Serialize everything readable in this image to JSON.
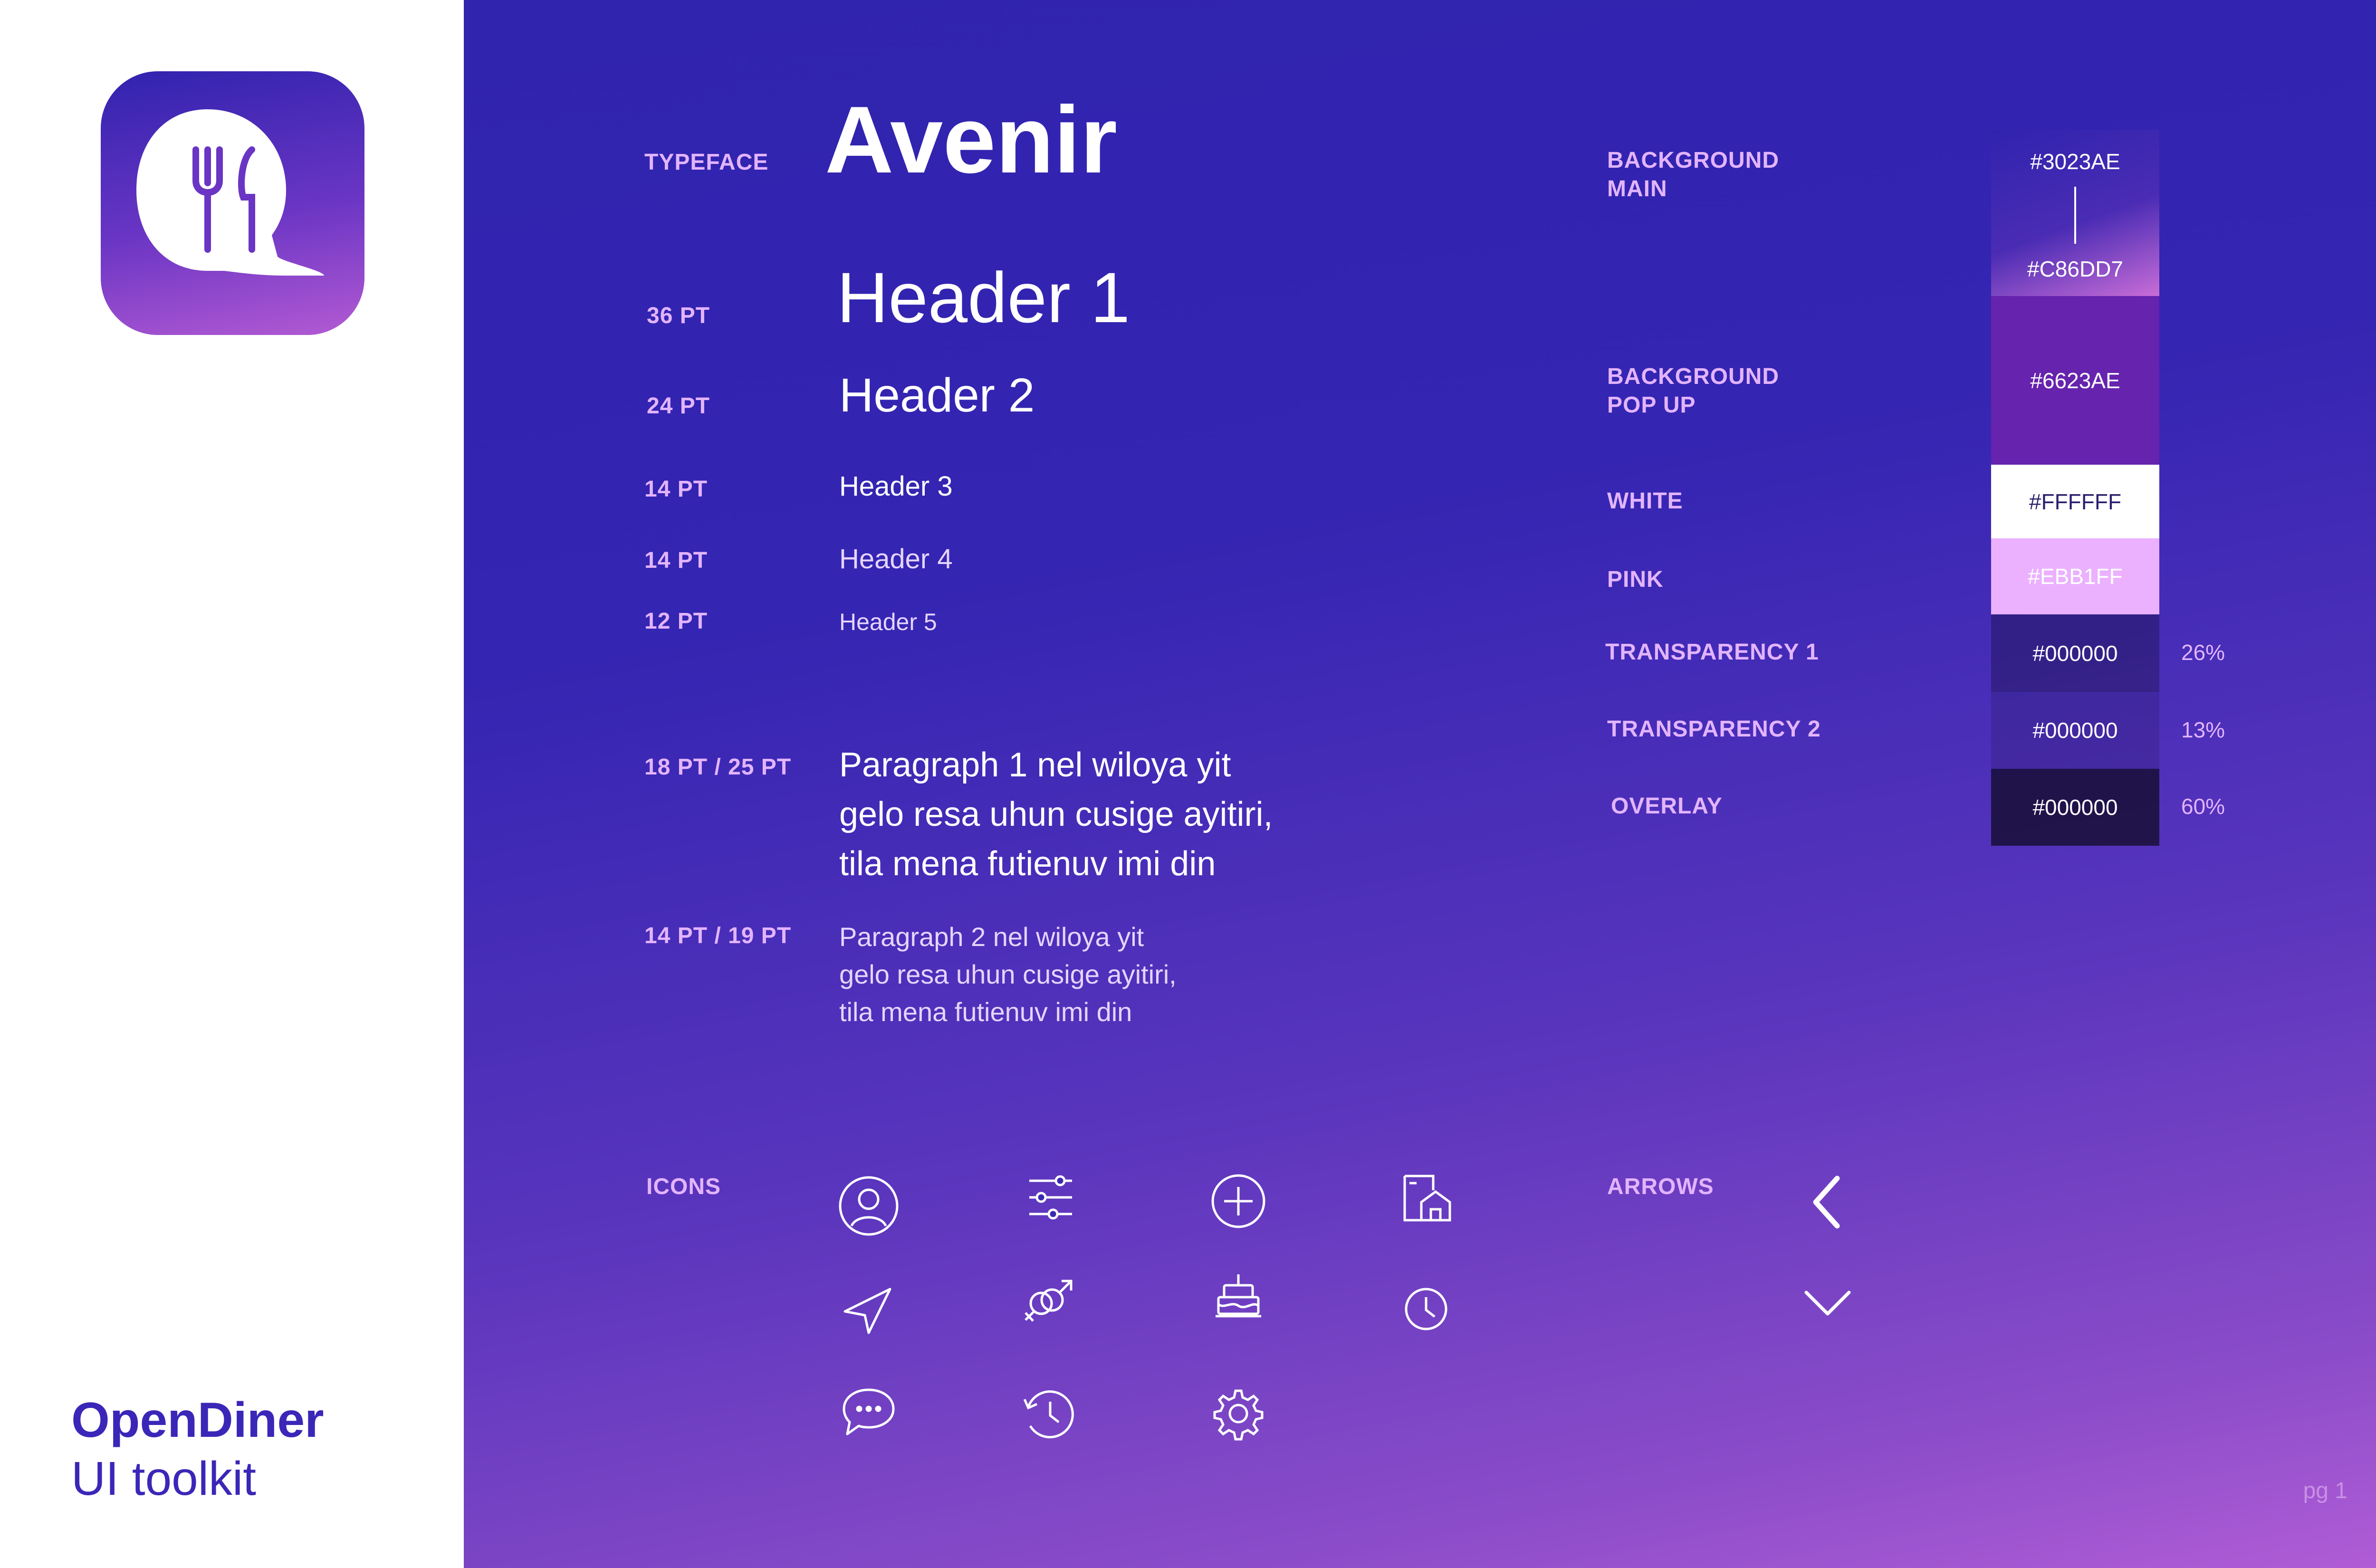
{
  "brand": {
    "name": "OpenDiner",
    "subtitle": "UI toolkit"
  },
  "typography": {
    "typeface_label": "TYPEFACE",
    "typeface_name": "Avenir",
    "rows": [
      {
        "size": "36 PT",
        "sample": "Header 1"
      },
      {
        "size": "24 PT",
        "sample": "Header 2"
      },
      {
        "size": "14 PT",
        "sample": "Header 3"
      },
      {
        "size": "14 PT",
        "sample": "Header 4"
      },
      {
        "size": "12 PT",
        "sample": "Header 5"
      }
    ],
    "paragraphs": [
      {
        "size": "18 PT / 25 PT",
        "lines": [
          "Paragraph 1 nel wiloya yit",
          "gelo resa uhun cusige ayitiri,",
          "tila mena futienuv imi din"
        ]
      },
      {
        "size": "14 PT / 19 PT",
        "lines": [
          "Paragraph 2 nel wiloya yit",
          "gelo resa uhun cusige ayitiri,",
          "tila mena futienuv imi din"
        ]
      }
    ]
  },
  "colors": [
    {
      "label": "BACKGROUND\nMAIN",
      "hex_top": "#3023AE",
      "hex_bottom": "#C86DD7",
      "swatch_from": "#3023AE",
      "swatch_to": "#C86DD7"
    },
    {
      "label": "BACKGROUND\nPOP UP",
      "hex": "#6623AE",
      "swatch": "#6623AE"
    },
    {
      "label": "WHITE",
      "hex": "#FFFFFF",
      "swatch": "#FFFFFF"
    },
    {
      "label": "PINK",
      "hex": "#EBB1FF",
      "swatch": "#EBB1FF"
    },
    {
      "label": "TRANSPARENCY 1",
      "hex": "#000000",
      "opacity": "26%",
      "swatch": "#000000"
    },
    {
      "label": "TRANSPARENCY 2",
      "hex": "#000000",
      "opacity": "13%",
      "swatch": "#000000"
    },
    {
      "label": "OVERLAY",
      "hex": "#000000",
      "opacity": "60%",
      "swatch": "#000000"
    }
  ],
  "icons": {
    "label": "ICONS",
    "items": [
      "user-circle-icon",
      "sliders-icon",
      "plus-circle-icon",
      "restaurant-home-icon",
      "navigation-arrow-icon",
      "gender-icon",
      "cake-icon",
      "clock-icon",
      "chat-bubble-icon",
      "history-icon",
      "gear-icon"
    ]
  },
  "arrows": {
    "label": "ARROWS",
    "items": [
      "chevron-left-icon",
      "chevron-down-icon"
    ]
  },
  "page": "pg 1"
}
